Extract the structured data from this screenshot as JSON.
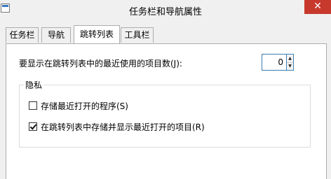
{
  "window": {
    "title": "任务栏和导航属性",
    "close_glyph": "✕"
  },
  "tabs": [
    {
      "label": "任务栏",
      "active": false
    },
    {
      "label": "导航",
      "active": false
    },
    {
      "label": "跳转列表",
      "active": true
    },
    {
      "label": "工具栏",
      "active": false
    }
  ],
  "jumplist": {
    "count_label": "要显示在跳转列表中的最近使用的项目数(J):",
    "count_value": "0",
    "spin_up": "▲",
    "spin_down": "▼"
  },
  "privacy": {
    "title": "隐私",
    "options": [
      {
        "label": "存储最近打开的程序(S)",
        "checked": false
      },
      {
        "label": "在跳转列表中存储并显示最近打开的项目(R)",
        "checked": true
      }
    ]
  },
  "colors": {
    "close_button": "#c7392d",
    "input_border": "#3c7fb1"
  },
  "icons": {
    "app": "window-app-icon",
    "close": "close-icon",
    "spin_up": "spin-up-arrow-icon",
    "spin_down": "spin-down-arrow-icon",
    "check": "checkmark-icon"
  }
}
